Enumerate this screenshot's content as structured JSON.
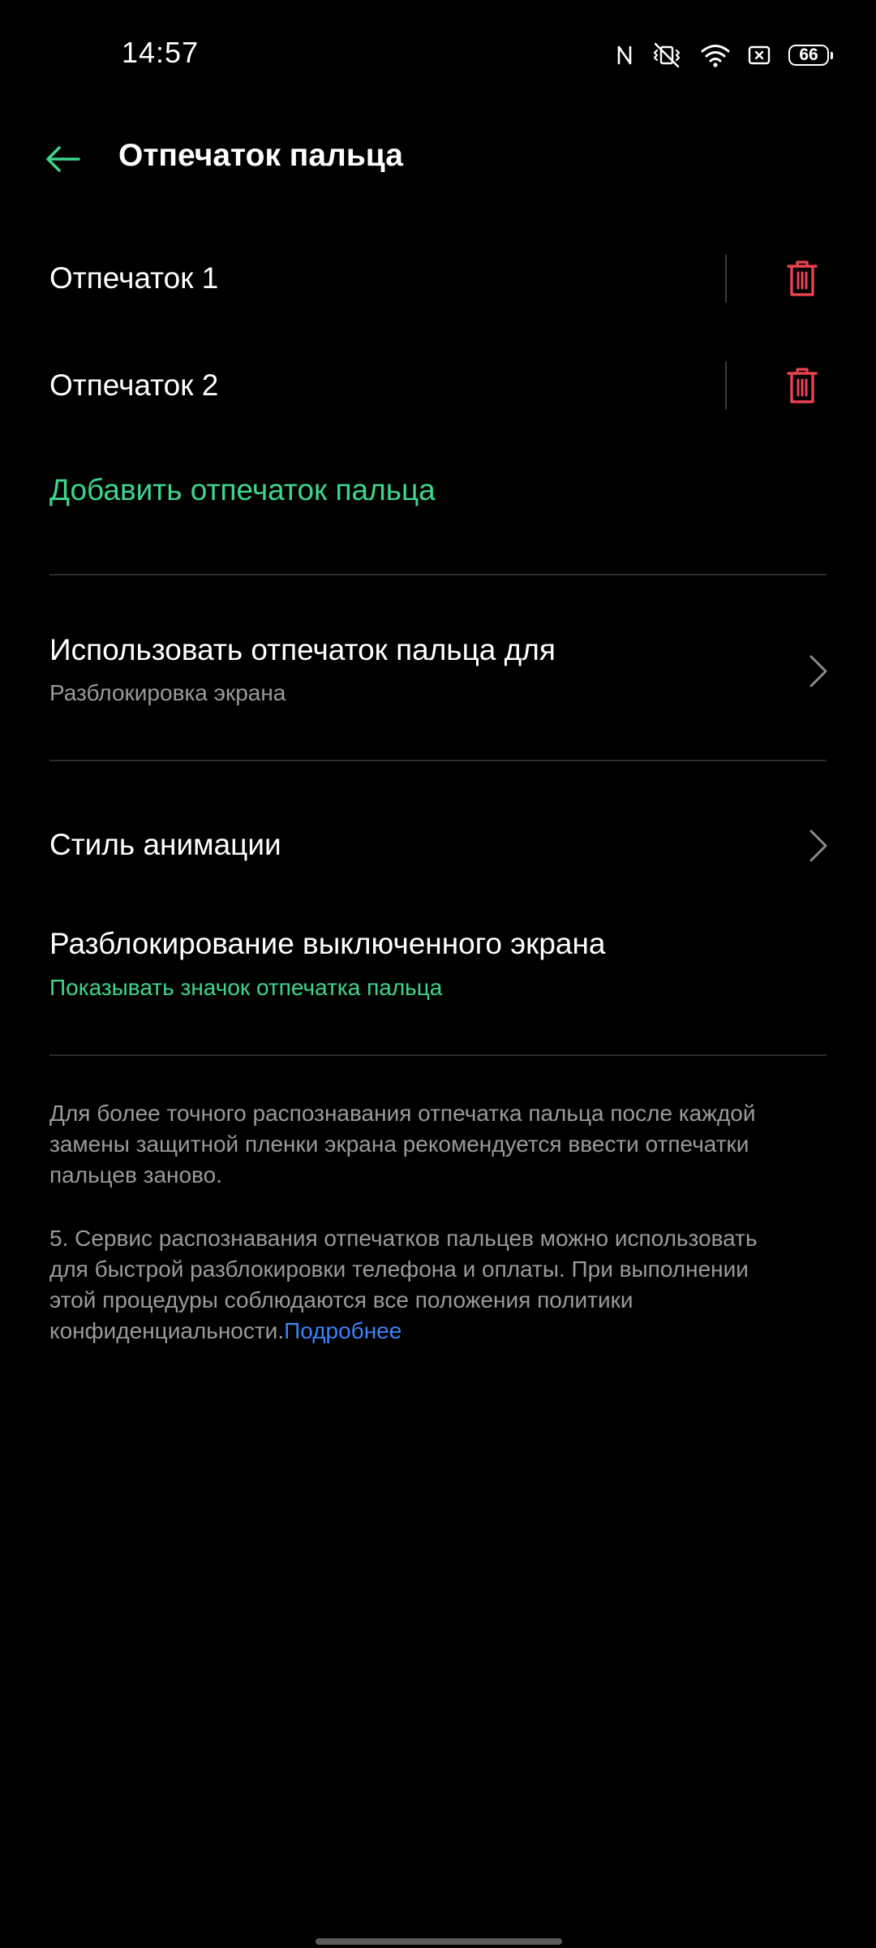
{
  "status_bar": {
    "time": "14:57",
    "battery": "66",
    "icons": [
      "nfc-icon",
      "vibrate-off-icon",
      "wifi-icon",
      "sim-icon",
      "battery-icon"
    ]
  },
  "header": {
    "back_icon": "arrow-left-icon",
    "title": "Отпечаток пальца"
  },
  "fingerprints": {
    "items": [
      {
        "label": "Отпечаток 1",
        "action_icon": "trash-icon"
      },
      {
        "label": "Отпечаток 2",
        "action_icon": "trash-icon"
      }
    ],
    "add_label": "Добавить отпечаток пальца"
  },
  "settings": {
    "use_for": {
      "title": "Использовать отпечаток пальца для",
      "subtitle": "Разблокировка экрана"
    },
    "animation_style": {
      "title": "Стиль анимации"
    },
    "screen_off_unlock": {
      "title": "Разблокирование выключенного экрана",
      "subtitle": "Показывать значок отпечатка пальца"
    }
  },
  "info": {
    "paragraph1": "Для более точного распознавания отпечатка пальца после каждой замены защитной пленки экрана рекомендуется ввести отпечатки пальцев заново.",
    "paragraph2": "5. Сервис распознавания отпечатков пальцев можно использовать для быстрой разблокировки телефона и оплаты. При выполнении этой процедуры соблюдаются все положения политики конфиденциальности.",
    "more_link": "Подробнее"
  },
  "colors": {
    "background": "#000000",
    "accent_green": "#3dd68c",
    "delete_red": "#e8434f",
    "link_blue": "#3b82f6",
    "secondary_text": "#9a9a9a"
  }
}
